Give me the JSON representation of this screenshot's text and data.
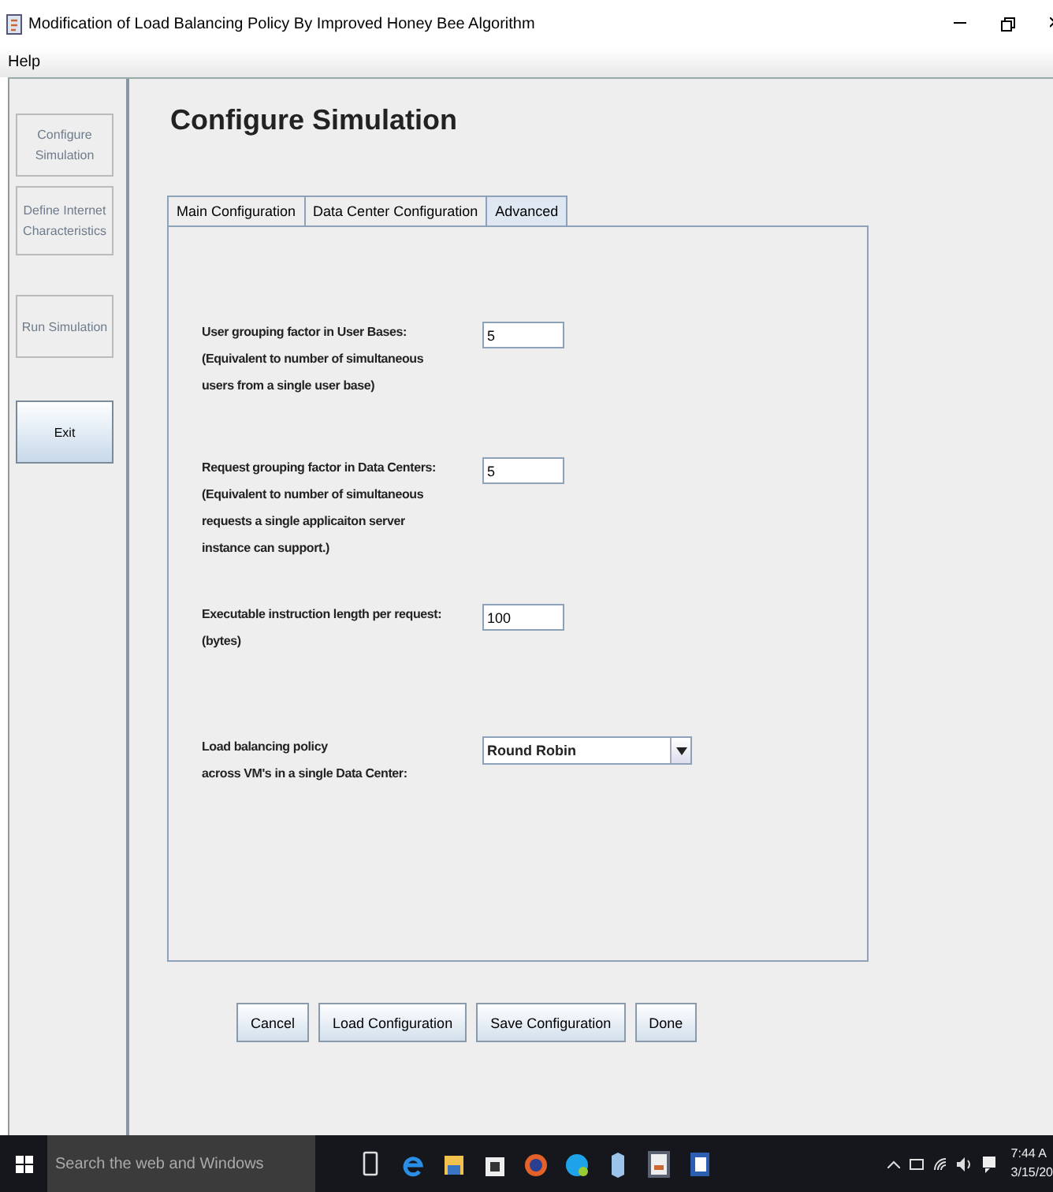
{
  "window": {
    "title": "Modification of Load Balancing Policy By Improved Honey Bee Algorithm"
  },
  "menu": [
    "Help"
  ],
  "sidebar": {
    "items": [
      {
        "label": "Configure Simulation",
        "disabled": true
      },
      {
        "label": "Define Internet Characteristics",
        "disabled": true
      },
      {
        "label": "Run Simulation",
        "disabled": true
      },
      {
        "label": "Exit",
        "disabled": false
      }
    ]
  },
  "heading": "Configure Simulation",
  "tabs": [
    {
      "label": "Main Configuration",
      "selected": false
    },
    {
      "label": "Data Center Configuration",
      "selected": false
    },
    {
      "label": "Advanced",
      "selected": true
    }
  ],
  "fields": [
    {
      "kind": "text",
      "lines": [
        "User grouping factor in User Bases:",
        "(Equivalent to number of simultaneous",
        "users from a single user base)"
      ],
      "value": "5"
    },
    {
      "kind": "text",
      "lines": [
        "Request grouping factor in Data Centers:",
        "(Equivalent to number of simultaneous",
        "requests a single applicaiton server",
        "instance can support.)"
      ],
      "value": "5"
    },
    {
      "kind": "text",
      "lines": [
        "Executable instruction length per request:",
        "(bytes)"
      ],
      "value": "100"
    },
    {
      "kind": "dropdown",
      "lines": [
        "Load balancing policy",
        "across VM's in a single Data Center:"
      ],
      "value": "Round Robin"
    }
  ],
  "buttons": [
    "Cancel",
    "Load Configuration",
    "Save Configuration",
    "Done"
  ],
  "taskbar": {
    "search_placeholder": "Search the web and Windows",
    "time": "7:44 A",
    "date": "3/15/20"
  }
}
